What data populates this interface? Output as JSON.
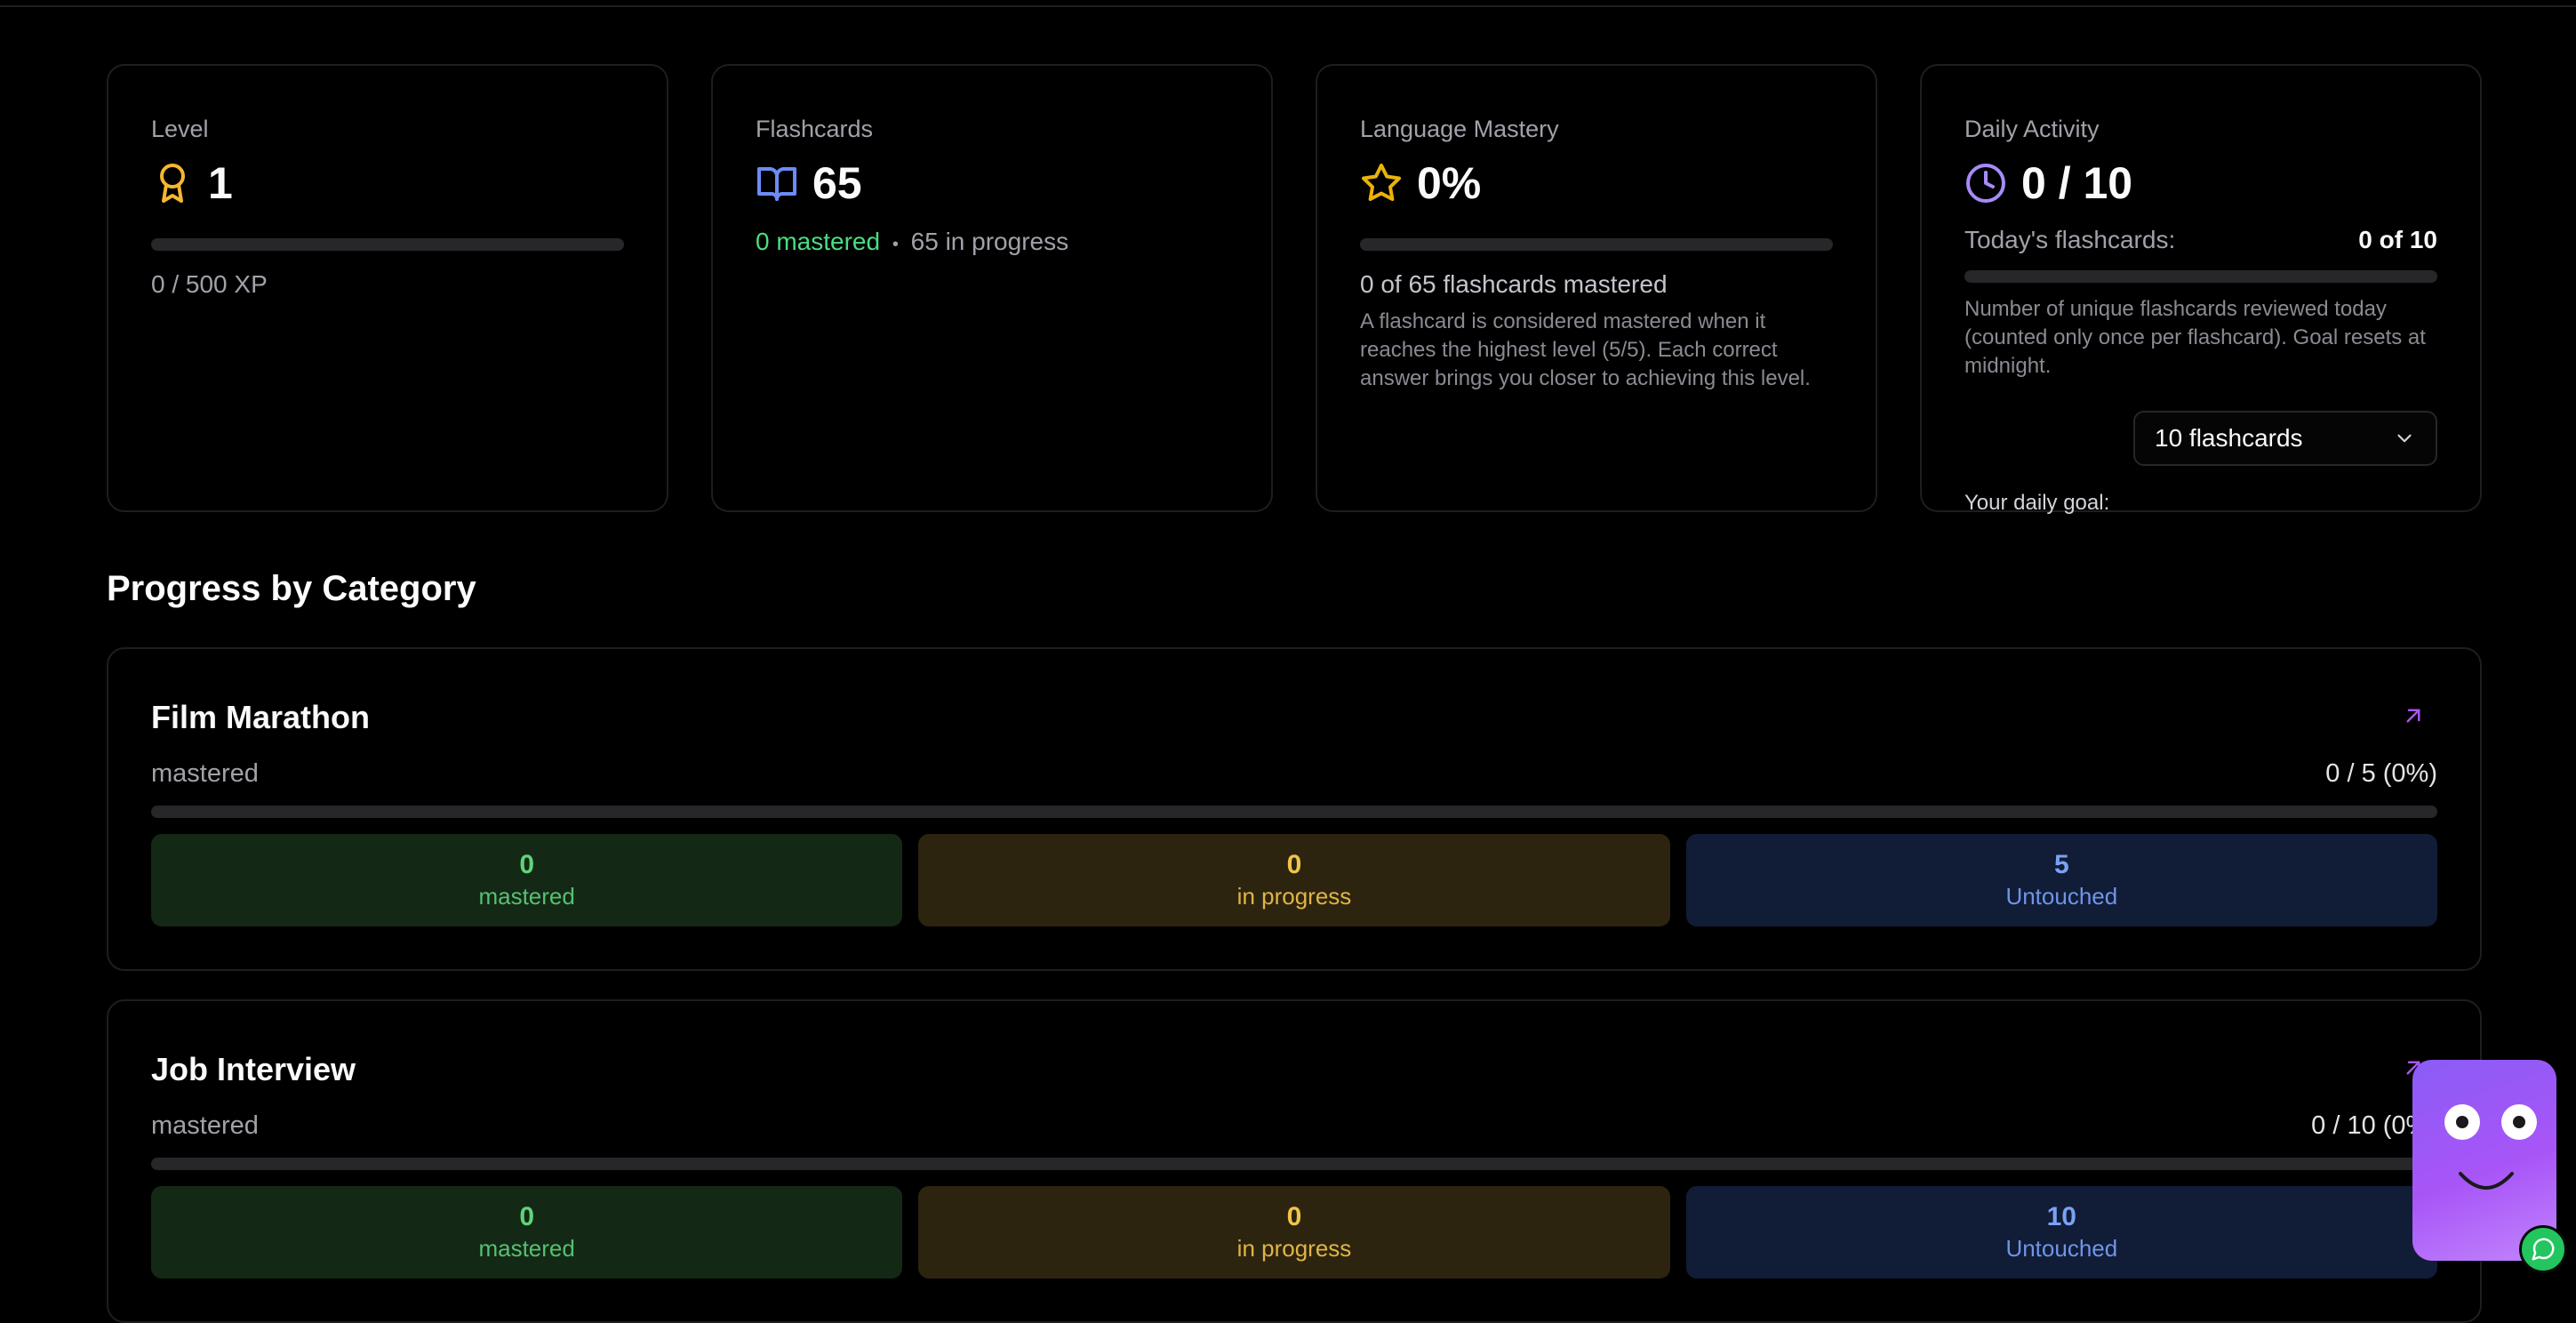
{
  "cards": {
    "level": {
      "label": "Level",
      "value": "1",
      "xp": "0 / 500 XP",
      "progress": 0
    },
    "flashcards": {
      "label": "Flashcards",
      "value": "65",
      "mastered": "0 mastered",
      "separator": "•",
      "in_progress": "65 in progress"
    },
    "mastery": {
      "label": "Language Mastery",
      "value": "0%",
      "progress": 0,
      "summary": "0 of 65 flashcards mastered",
      "description": "A flashcard is considered mastered when it reaches the highest level (5/5). Each correct answer brings you closer to achieving this level."
    },
    "daily": {
      "label": "Daily Activity",
      "value": "0 / 10",
      "today_label": "Today's flashcards:",
      "today_value": "0 of 10",
      "progress": 0,
      "description": "Number of unique flashcards reviewed today (counted only once per flashcard). Goal resets at midnight.",
      "goal_label": "Your daily goal:",
      "goal_value": "10 flashcards"
    }
  },
  "section_title": "Progress by Category",
  "categories": [
    {
      "name": "Film Marathon",
      "sublabel": "mastered",
      "count": "0 / 5 (0%)",
      "progress": 0,
      "mastered": "0",
      "mastered_label": "mastered",
      "in_progress": "0",
      "in_progress_label": "in progress",
      "untouched": "5",
      "untouched_label": "Untouched"
    },
    {
      "name": "Job Interview",
      "sublabel": "mastered",
      "count": "0 / 10 (0%)",
      "progress": 0,
      "mastered": "0",
      "mastered_label": "mastered",
      "in_progress": "0",
      "in_progress_label": "in progress",
      "untouched": "10",
      "untouched_label": "Untouched"
    }
  ],
  "colors": {
    "accent_purple": "#a855f7",
    "level_icon": "#f5b72e",
    "book_icon": "#6b8cf5",
    "star_icon": "#eab308",
    "clock_icon": "#a78bfa",
    "mastered_green": "#4ade80"
  },
  "icons": [
    "award-icon",
    "book-open-icon",
    "star-icon",
    "clock-icon",
    "arrow-up-right-icon",
    "chevron-down-icon",
    "chat-icon"
  ]
}
